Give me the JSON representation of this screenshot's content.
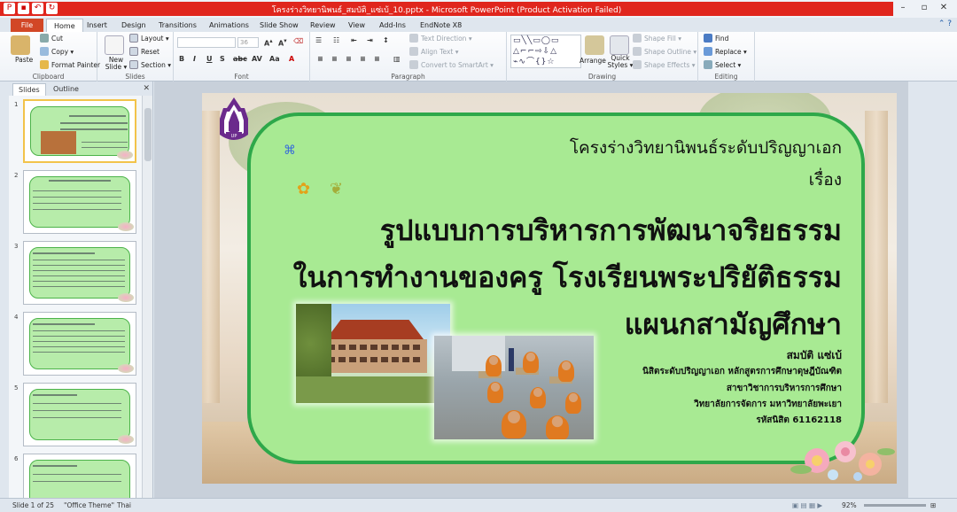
{
  "window": {
    "title": "โครงร่างวิทยานิพนธ์_สมบัติ_แซ่เบ้_10.pptx  -  Microsoft PowerPoint (Product Activation Failed)"
  },
  "ribbon_tabs": [
    "File",
    "Home",
    "Insert",
    "Design",
    "Transitions",
    "Animations",
    "Slide Show",
    "Review",
    "View",
    "Add-Ins",
    "EndNote X8"
  ],
  "ribbon": {
    "clipboard": {
      "paste": "Paste",
      "cut": "Cut",
      "copy": "Copy ▾",
      "format_painter": "Format Painter",
      "label": "Clipboard"
    },
    "slides": {
      "new_slide": "New Slide ▾",
      "layout": "Layout ▾",
      "reset": "Reset",
      "section": "Section ▾",
      "label": "Slides"
    },
    "font": {
      "size": "36",
      "label": "Font"
    },
    "paragraph": {
      "text_direction": "Text Direction ▾",
      "align_text": "Align Text ▾",
      "convert_smartart": "Convert to SmartArt ▾",
      "label": "Paragraph"
    },
    "drawing": {
      "arrange": "Arrange",
      "quick_styles": "Quick Styles ▾",
      "shape_fill": "Shape Fill ▾",
      "shape_outline": "Shape Outline ▾",
      "shape_effects": "Shape Effects ▾",
      "label": "Drawing"
    },
    "editing": {
      "find": "Find",
      "replace": "Replace ▾",
      "select": "Select ▾",
      "label": "Editing"
    }
  },
  "left_pane": {
    "tab_slides": "Slides",
    "tab_outline": "Outline",
    "close": "✕",
    "slide_numbers": [
      "1",
      "2",
      "3",
      "4",
      "5",
      "6"
    ]
  },
  "slide": {
    "header": "โครงร่างวิทยานิพนธ์ระดับปริญญาเอก",
    "subject_label": "เรื่อง",
    "title_line1": "รูปแบบการบริหารการพัฒนาจริยธรรม",
    "title_line2": "ในการทำงานของครู โรงเรียนพระปริยัติธรรม",
    "title_line3": "แผนกสามัญศึกษา",
    "author": "สมบัติ แซ่เบ้",
    "line1": "นิสิตระดับปริญญาเอก หลักสูตรการศึกษาดุษฎีบัณฑิต",
    "line2": "สาขาวิชาการบริหารการศึกษา",
    "line3": "วิทยาลัยการจัดการ มหาวิทยาลัยพะเยา",
    "line4": "รหัสนิสิต 61162118"
  },
  "status": {
    "slide_of": "Slide 1 of 25",
    "theme": "\"Office Theme\"",
    "language": "Thai",
    "zoom": "92%"
  },
  "colors": {
    "title_red": "#e0261d",
    "slide_green": "#a8ea93",
    "slide_border": "#2ea84a",
    "file_tab": "#d24726"
  }
}
